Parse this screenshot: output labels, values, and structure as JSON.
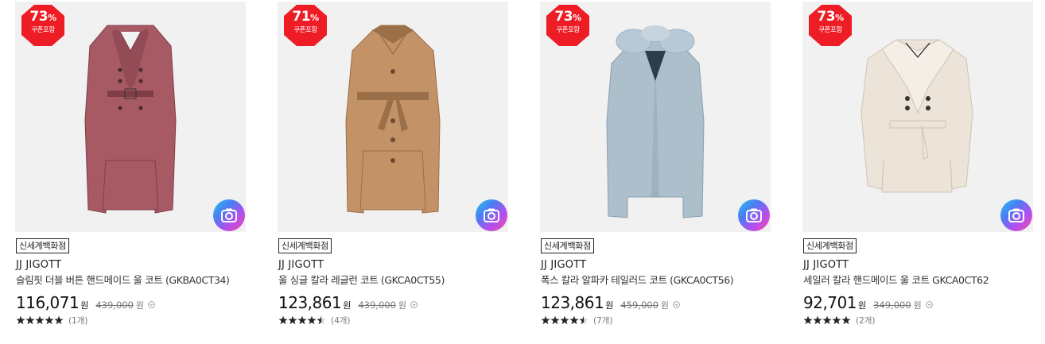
{
  "colors": {
    "badge_red": "#ee1c25",
    "accent_gradient": [
      "#23c5f0",
      "#b14ff0",
      "#f24aa6"
    ]
  },
  "products": [
    {
      "discount": "73",
      "percent_sign": "%",
      "coupon_label": "쿠폰포함",
      "store_tag": "신세계백화점",
      "brand": "JJ JIGOTT",
      "name": "슬림핏 더블 버튼 핸드메이드 울 코트 (GKBA0CT34)",
      "price": "116,071",
      "currency": "원",
      "original_price": "439,000",
      "original_currency": "원",
      "rating": 5,
      "review_count": "(1개)",
      "image": {
        "description_icon": "coat-image",
        "coat_color": "#a75a63",
        "coat_shade": "#7f3e47",
        "style": "long-double"
      }
    },
    {
      "discount": "71",
      "percent_sign": "%",
      "coupon_label": "쿠폰포함",
      "store_tag": "신세계백화점",
      "brand": "JJ JIGOTT",
      "name": "울 싱글 칼라 레글런 코트 (GKCA0CT55)",
      "price": "123,861",
      "currency": "원",
      "original_price": "439,000",
      "original_currency": "원",
      "rating": 4.5,
      "review_count": "(4개)",
      "image": {
        "description_icon": "coat-image",
        "coat_color": "#c39266",
        "coat_shade": "#9b6f48",
        "style": "long-belt"
      }
    },
    {
      "discount": "73",
      "percent_sign": "%",
      "coupon_label": "쿠폰포함",
      "store_tag": "신세계백화점",
      "brand": "JJ JIGOTT",
      "name": "폭스 칼라 알파카 테일러드 코트 (GKCA0CT56)",
      "price": "123,861",
      "currency": "원",
      "original_price": "459,000",
      "original_currency": "원",
      "rating": 4.5,
      "review_count": "(7개)",
      "image": {
        "description_icon": "coat-image",
        "coat_color": "#aebfcc",
        "coat_shade": "#8aa0b1",
        "style": "long-fur"
      }
    },
    {
      "discount": "73",
      "percent_sign": "%",
      "coupon_label": "쿠폰포함",
      "store_tag": "신세계백화점",
      "brand": "JJ JIGOTT",
      "name": "세일러 칼라 핸드메이드 울 코트 GKCA0CT62",
      "price": "92,701",
      "currency": "원",
      "original_price": "349,000",
      "original_currency": "원",
      "rating": 5,
      "review_count": "(2개)",
      "image": {
        "description_icon": "coat-image",
        "coat_color": "#ece3d9",
        "coat_shade": "#cfc3b5",
        "style": "short-double"
      }
    }
  ]
}
